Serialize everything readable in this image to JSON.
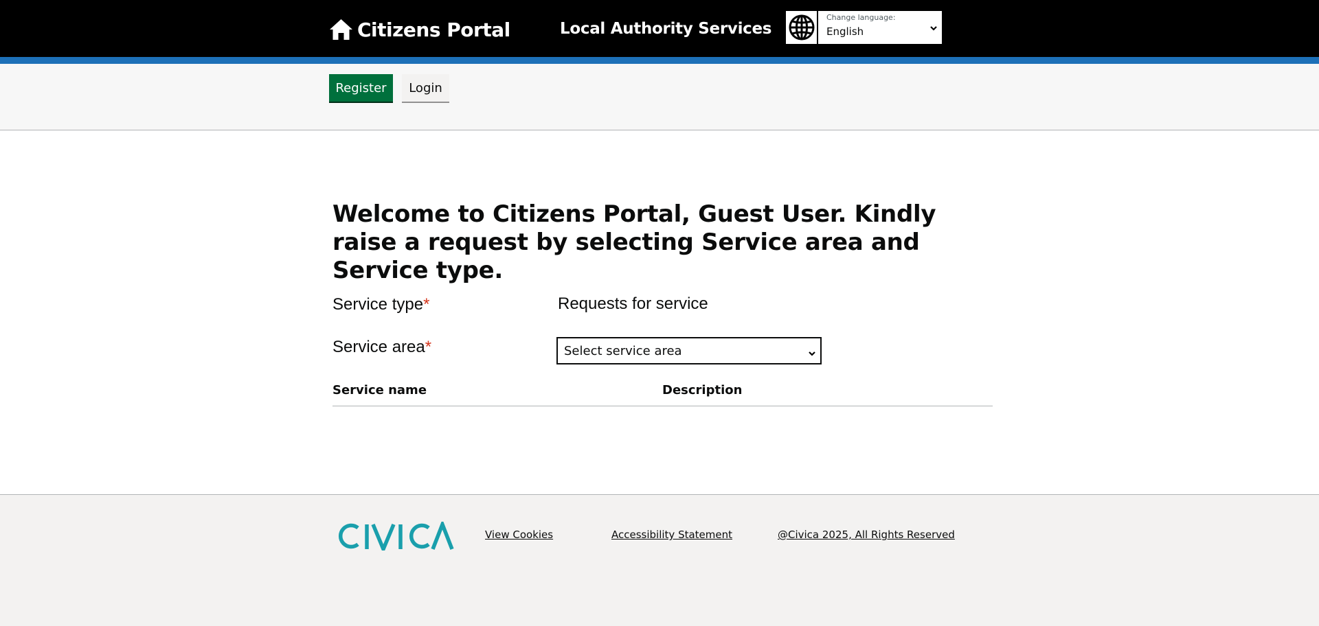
{
  "header": {
    "brand": "Citizens Portal",
    "service_name": "Local Authority Services",
    "language": {
      "caption": "Change language:",
      "selected": "English"
    }
  },
  "nav": {
    "register_label": "Register",
    "login_label": "Login"
  },
  "main": {
    "welcome": "Welcome to Citizens Portal, Guest User. Kindly raise a request by selecting Service area and Service type.",
    "service_type_label": "Service type",
    "service_type_value": "Requests for service",
    "service_area_label": "Service area",
    "service_area_selected": "Select service area",
    "required_marker": "*",
    "table": {
      "columns": [
        "Service name",
        "Description"
      ]
    }
  },
  "footer": {
    "logo_text": "CIVICA",
    "links": [
      "View Cookies",
      "Accessibility Statement",
      "@Civica 2025, All Rights Reserved"
    ]
  },
  "colors": {
    "header_bg": "#000000",
    "header_stripe": "#1d70b8",
    "register_green": "#00703c",
    "required_red": "#d4351c",
    "civica_teal": "#1a9fac"
  },
  "icons": {
    "brand": "home-icon",
    "language": "globe-icon",
    "dropdown": "chevron-down-icon"
  }
}
